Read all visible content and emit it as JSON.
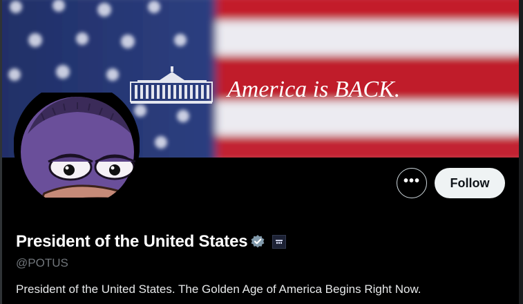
{
  "profile": {
    "display_name": "President of the United States",
    "handle": "@POTUS",
    "bio": "President of the United States. The Golden Age of America Begins Right Now."
  },
  "banner": {
    "headline": "America is BACK."
  },
  "actions": {
    "more_label": "•••",
    "follow_label": "Follow"
  },
  "icons": {
    "verified": "verified-badge-icon",
    "affiliation": "affiliation-badge-icon",
    "more": "more-options-icon"
  },
  "colors": {
    "background": "#000000",
    "follow_button": "#eff3f4",
    "verified_badge": "#829aab",
    "handle_text": "#71767b"
  }
}
